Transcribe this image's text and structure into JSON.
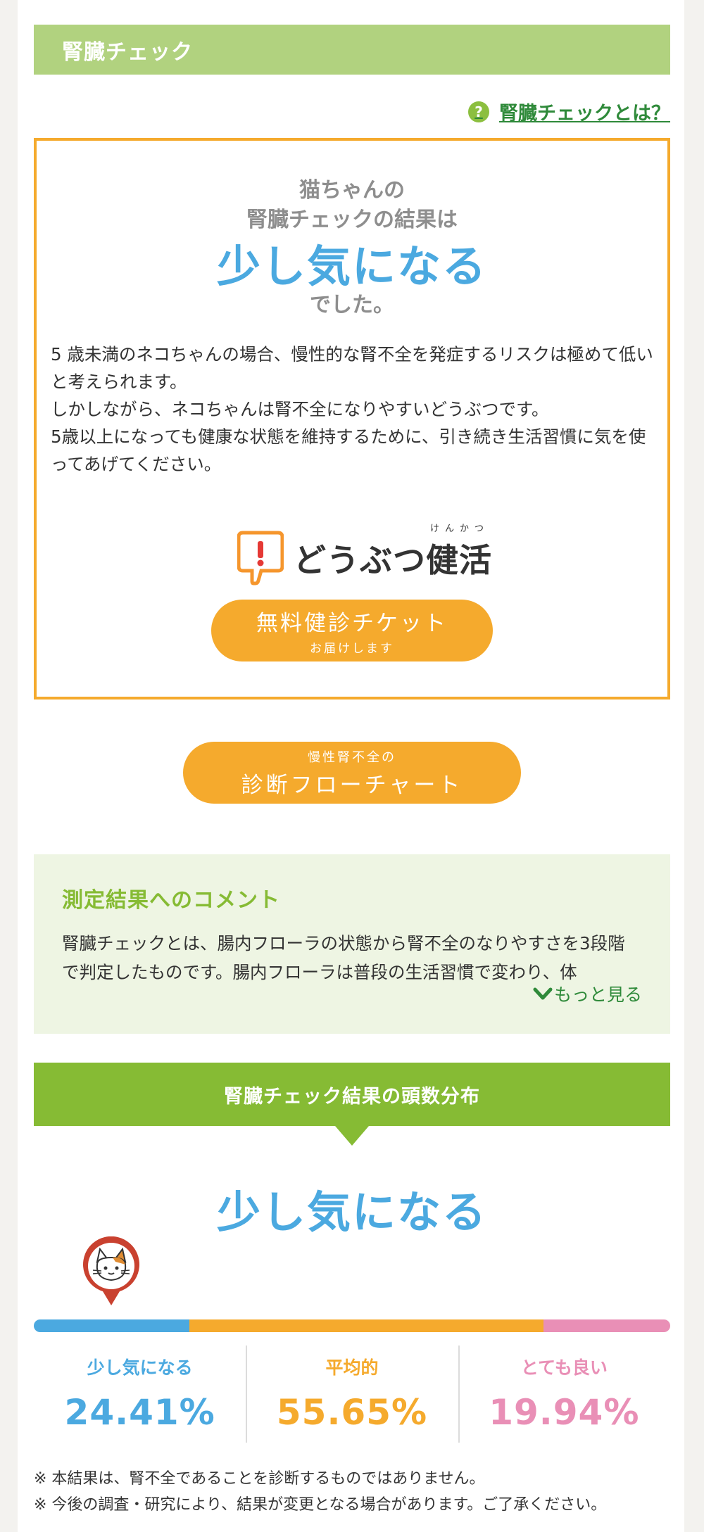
{
  "section_title": "腎臓チェック",
  "help_link": {
    "icon": "?",
    "label": "腎臓チェックとは？"
  },
  "result": {
    "line1": "猫ちゃんの",
    "line2": "腎臓チェックの結果は",
    "level": "少し気になる",
    "line4": "でした。",
    "description_lines": [
      "5 歳未満のネコちゃんの場合、慢性的な腎不全を発症するリスクは極めて低いと考えられます。",
      "しかしながら、ネコちゃんは腎不全になりやすいどうぶつです。",
      "5歳以上になっても健康な状態を維持するために、引き続き生活習慣に気を使ってあげてください。"
    ]
  },
  "brand": {
    "name": "どうぶつ健活",
    "ruby": "けんかつ"
  },
  "ticket_button": {
    "main": "無料健診チケット",
    "sub": "お届けします"
  },
  "flow_button": {
    "sub": "慢性腎不全の",
    "main": "診断フローチャート"
  },
  "comment": {
    "title": "測定結果へのコメント",
    "text": "腎臓チェックとは、腸内フローラの状態から腎不全のなりやすさを3段階で判定したものです。腸内フローラは普段の生活習慣で変わり、体",
    "more_label": "もっと見る"
  },
  "distribution": {
    "title": "腎臓チェック結果の頭数分布",
    "current": "少し気になる",
    "categories": [
      {
        "label": "少し気になる",
        "value": "24.41%",
        "fraction": 0.2441,
        "color": "#4ba9e0"
      },
      {
        "label": "平均的",
        "value": "55.65%",
        "fraction": 0.5565,
        "color": "#f5aa2d"
      },
      {
        "label": "とても良い",
        "value": "19.94%",
        "fraction": 0.1994,
        "color": "#e98fb6"
      }
    ]
  },
  "notes": [
    "※  本結果は、腎不全であることを診断するものではありません。",
    "※  今後の調査・研究により、結果が変更となる場合があります。ご了承ください。"
  ],
  "colors": {
    "header": "#b1d27f",
    "accent_orange": "#f5aa2d",
    "accent_blue": "#4ba9e0",
    "accent_green": "#86bb34",
    "link": "#2f8a3a"
  }
}
